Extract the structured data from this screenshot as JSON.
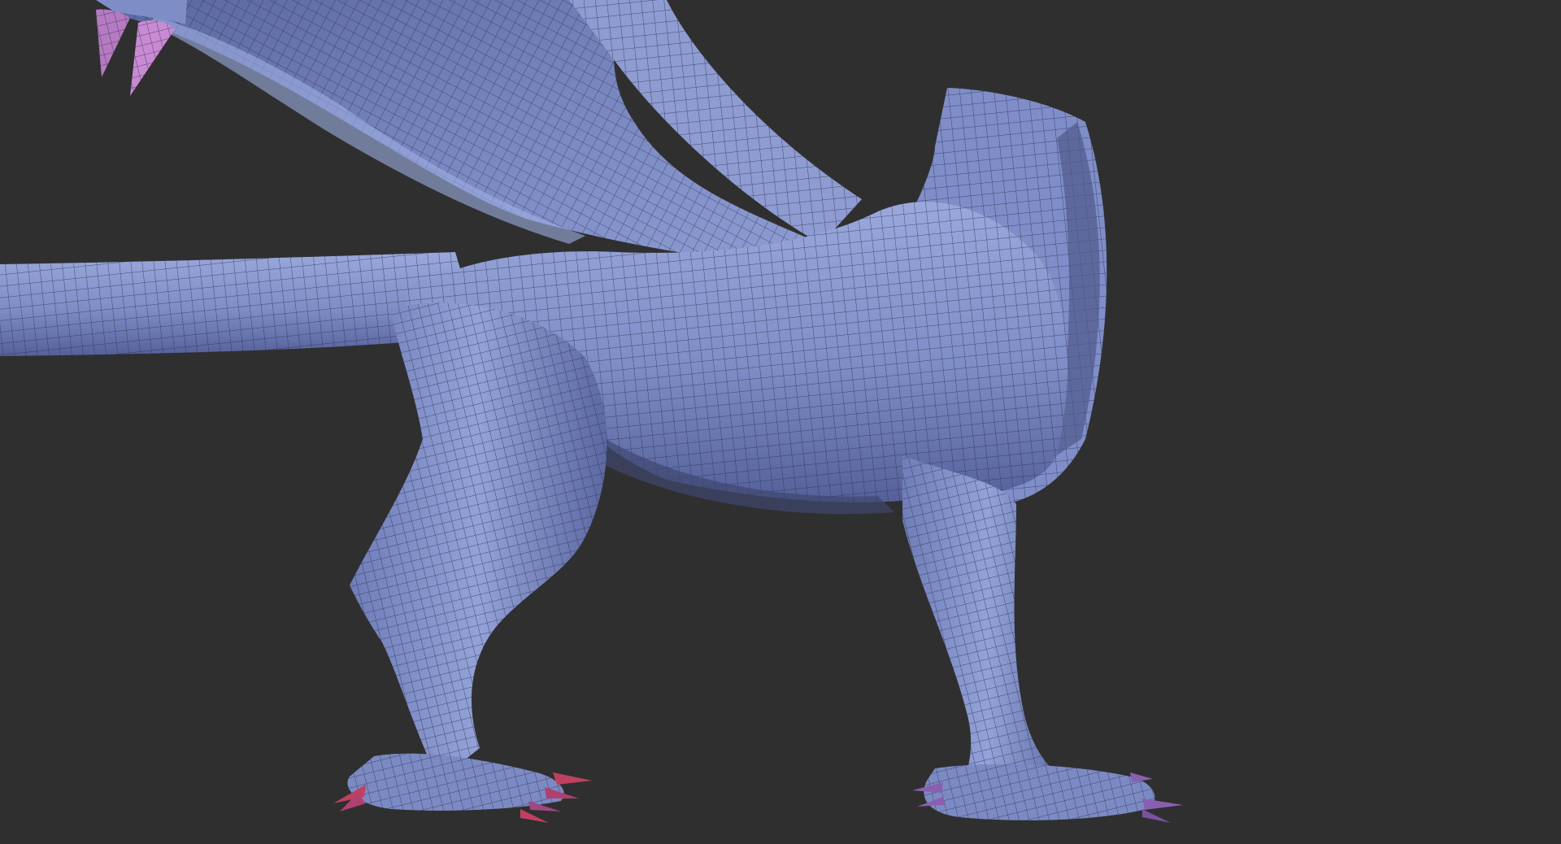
{
  "viewport": {
    "background_color": "#2f2f2f"
  },
  "model": {
    "subject": "dragon-base-mesh",
    "mesh_color": "#7f8fc8",
    "mesh_shadow_color": "#4f5a8a",
    "mesh_highlight_color": "#a9b7e6",
    "wire_color": "#2a2f48",
    "claw_color_front": "#b06a9a",
    "claw_color_back": "#8a5fb0",
    "claw_tip_color": "#c04060",
    "horn_color": "#c07ac8"
  }
}
